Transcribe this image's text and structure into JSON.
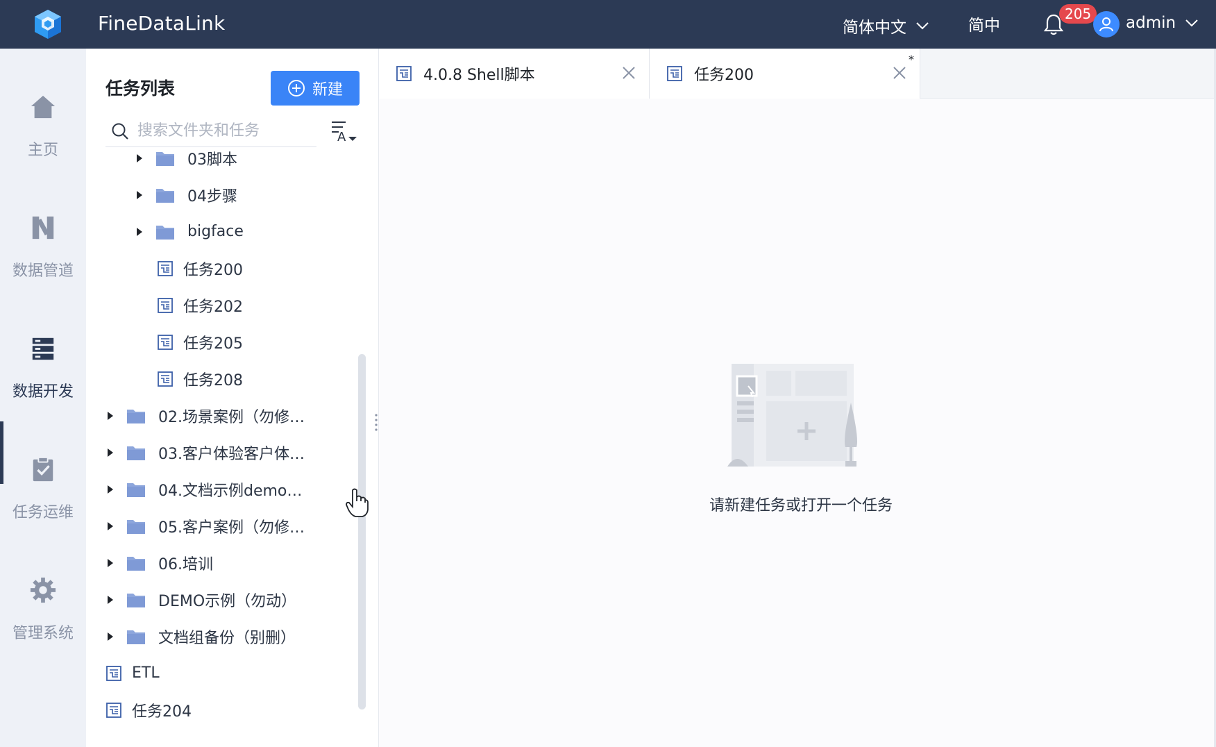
{
  "header": {
    "app_title": "FineDataLink",
    "language": "简体中文",
    "simplified_toggle": "简中",
    "notification_count": "205",
    "user": "admin"
  },
  "rail": {
    "items": [
      {
        "label": "主页",
        "icon": "home-icon"
      },
      {
        "label": "数据管道",
        "icon": "pipeline-icon"
      },
      {
        "label": "数据开发",
        "icon": "data-dev-icon",
        "active": true
      },
      {
        "label": "任务运维",
        "icon": "task-ops-icon"
      },
      {
        "label": "管理系统",
        "icon": "gear-icon"
      }
    ]
  },
  "panel": {
    "title": "任务列表",
    "new_button": "新建",
    "search_placeholder": "搜索文件夹和任务"
  },
  "tree": [
    {
      "label": "03脚本",
      "type": "folder",
      "level": 2,
      "expandable": true
    },
    {
      "label": "04步骤",
      "type": "folder",
      "level": 2,
      "expandable": true
    },
    {
      "label": "bigface",
      "type": "folder",
      "level": 2,
      "expandable": true
    },
    {
      "label": "任务200",
      "type": "task",
      "level": 2
    },
    {
      "label": "任务202",
      "type": "task",
      "level": 2
    },
    {
      "label": "任务205",
      "type": "task",
      "level": 2
    },
    {
      "label": "任务208",
      "type": "task",
      "level": 2
    },
    {
      "label": "02.场景案例（勿修…",
      "type": "folder",
      "level": 1,
      "expandable": true
    },
    {
      "label": "03.客户体验客户体…",
      "type": "folder",
      "level": 1,
      "expandable": true
    },
    {
      "label": "04.文档示例demo…",
      "type": "folder",
      "level": 1,
      "expandable": true
    },
    {
      "label": "05.客户案例（勿修…",
      "type": "folder",
      "level": 1,
      "expandable": true
    },
    {
      "label": "06.培训",
      "type": "folder",
      "level": 1,
      "expandable": true
    },
    {
      "label": "DEMO示例（勿动）",
      "type": "folder",
      "level": 1,
      "expandable": true
    },
    {
      "label": "文档组备份（别删）",
      "type": "folder",
      "level": 1,
      "expandable": true
    },
    {
      "label": "ETL",
      "type": "task",
      "level": 1
    },
    {
      "label": "任务204",
      "type": "task",
      "level": 1
    }
  ],
  "tabs": [
    {
      "label": "4.0.8 Shell脚本",
      "dirty": false
    },
    {
      "label": "任务200",
      "dirty": true,
      "dirty_mark": "*"
    }
  ],
  "empty_state": {
    "message": "请新建任务或打开一个任务"
  },
  "colors": {
    "header_bg": "#2c3a55",
    "primary": "#3a84f7",
    "badge": "#e5484d",
    "folder": "#8da6dc",
    "rail_bg": "#eef1f7"
  }
}
